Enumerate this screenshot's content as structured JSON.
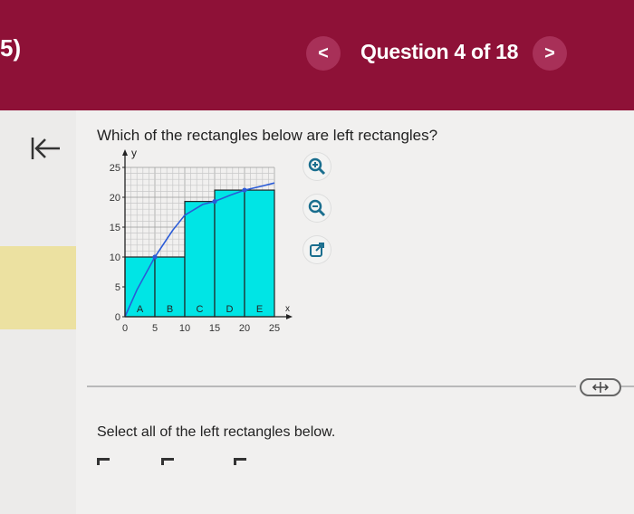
{
  "header": {
    "question_number": "5)",
    "prev_label": "<",
    "title": "Question 4 of 18",
    "next_label": ">"
  },
  "question": {
    "text": "Which of the rectangles below are left rectangles?",
    "instruction": "Select all of the left rectangles below."
  },
  "tools": [
    "zoom-in-icon",
    "zoom-out-icon",
    "popout-icon"
  ],
  "colors": {
    "header": "#8e1137",
    "bar_fill": "#00e5e5",
    "curve": "#2a5bd7"
  },
  "chart_data": {
    "type": "bar",
    "x_label": "x",
    "y_label": "y",
    "x_ticks": [
      0,
      5,
      10,
      15,
      20,
      25
    ],
    "y_ticks": [
      0,
      5,
      10,
      15,
      20,
      25
    ],
    "xlim": [
      0,
      25
    ],
    "ylim": [
      0,
      25
    ],
    "grid": true,
    "rectangles": [
      {
        "label": "A",
        "x0": 0,
        "x1": 5,
        "height": 10
      },
      {
        "label": "B",
        "x0": 5,
        "x1": 10,
        "height": 10
      },
      {
        "label": "C",
        "x0": 10,
        "x1": 15,
        "height": 19.3
      },
      {
        "label": "D",
        "x0": 15,
        "x1": 20,
        "height": 21.2
      },
      {
        "label": "E",
        "x0": 20,
        "x1": 25,
        "height": 21.2
      }
    ],
    "curve": [
      [
        0,
        0
      ],
      [
        2,
        4.5
      ],
      [
        5,
        10
      ],
      [
        8,
        14.5
      ],
      [
        10,
        17
      ],
      [
        13,
        18.8
      ],
      [
        15,
        19.3
      ],
      [
        18,
        20.5
      ],
      [
        20,
        21.2
      ],
      [
        23,
        21.9
      ],
      [
        25,
        22.4
      ]
    ],
    "curve_points": [
      [
        5,
        10
      ],
      [
        15,
        19.3
      ],
      [
        20,
        21.2
      ]
    ]
  }
}
